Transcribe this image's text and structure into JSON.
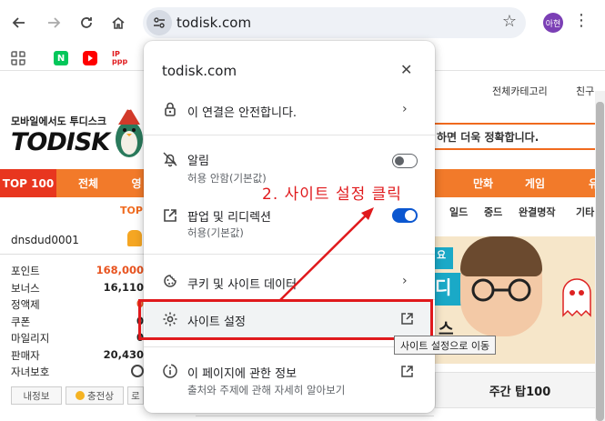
{
  "browser": {
    "url": "todisk.com",
    "profile_label": "아현"
  },
  "page": {
    "top_links": [
      "전체카테고리",
      "친구"
    ],
    "logo_tagline": "모바일에서도 투디스크",
    "logo_text": "TODISK",
    "search_placeholder": "하면 더욱 정확합니다.",
    "categories": [
      "TOP 100",
      "전체",
      "영",
      "만화",
      "게임",
      "유"
    ],
    "mini_label": "TOP",
    "subcategories": [
      "일드",
      "중드",
      "완결명작",
      "기타"
    ],
    "banner_text": "요",
    "banner_big": "디",
    "banner_small": "스",
    "weekly_label": "주간 탑100",
    "user": {
      "username": "dnsdud0001",
      "rows": [
        {
          "label": "포인트",
          "value": "168,000",
          "color": "#e8531f"
        },
        {
          "label": "보너스",
          "value": "16,110",
          "color": "#222222"
        },
        {
          "label": "정액제",
          "value": "0",
          "color": "#e8531f"
        },
        {
          "label": "쿠폰",
          "value": "0",
          "color": "#222222"
        },
        {
          "label": "마일리지",
          "value": "0",
          "color": "#222222"
        },
        {
          "label": "판매자",
          "value": "20,430",
          "color": "#222222"
        },
        {
          "label": "자녀보호",
          "value": "",
          "color": "#222222"
        }
      ],
      "buttons": [
        "내정보",
        "충전상",
        "로"
      ]
    }
  },
  "popup": {
    "title": "todisk.com",
    "secure_label": "이 연결은 안전합니다.",
    "notifications": {
      "label": "알림",
      "sub": "허용 안함(기본값)",
      "enabled": false
    },
    "popups": {
      "label": "팝업 및 리디렉션",
      "sub": "허용(기본값)",
      "enabled": true
    },
    "cookies_label": "쿠키 및 사이트 데이터",
    "site_settings_label": "사이트 설정",
    "page_info": {
      "label": "이 페이지에 관한 정보",
      "sub": "출처와 주제에 관해 자세히 알아보기"
    }
  },
  "tooltip": "사이트 설정으로 이동",
  "annotation": {
    "instruction": "2. 사이트 설정 클릭",
    "color": "#e0191c"
  },
  "colors": {
    "accent": "#f27a2a",
    "toggle_on": "#0b57d0"
  }
}
